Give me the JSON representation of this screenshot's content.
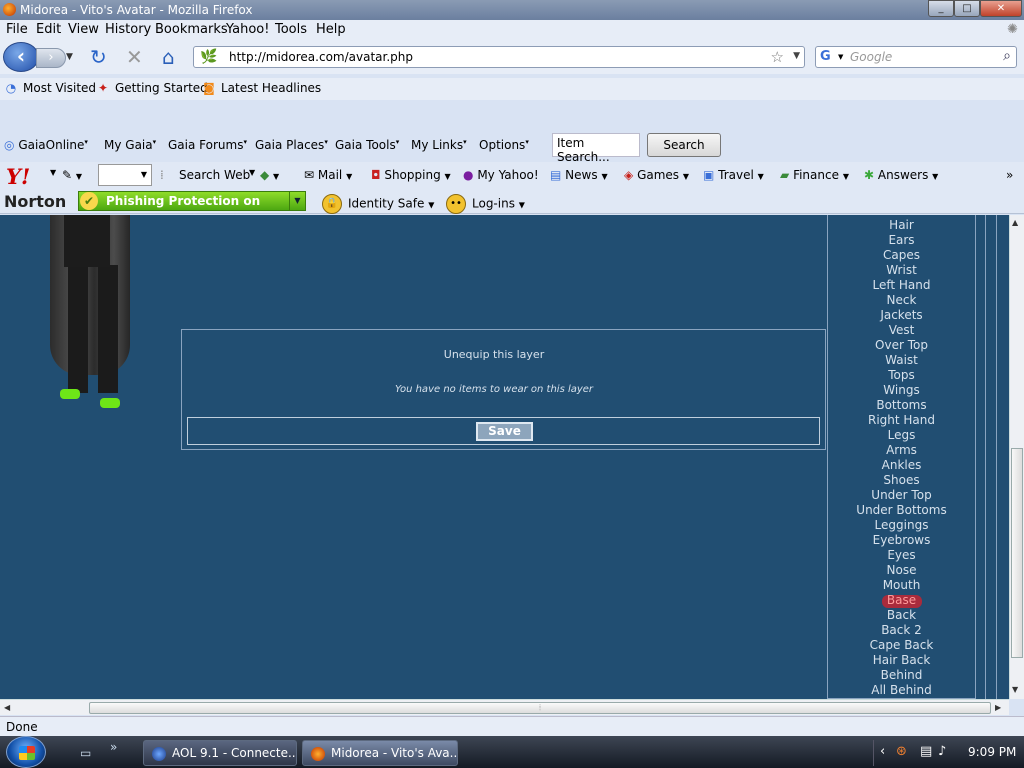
{
  "window": {
    "title": "Midorea - Vito's Avatar - Mozilla Firefox",
    "min": "_",
    "max": "□",
    "close": "✕"
  },
  "menu": [
    "File",
    "Edit",
    "View",
    "History",
    "Bookmarks",
    "Yahoo!",
    "Tools",
    "Help"
  ],
  "nav": {
    "url": "http://midorea.com/avatar.php",
    "search_placeholder": "Google",
    "icons": [
      "back-icon",
      "forward-icon",
      "reload-icon",
      "stop-icon",
      "home-icon",
      "bookmark-star-icon",
      "search-icon"
    ]
  },
  "bookmarks": [
    {
      "label": "Most Visited",
      "icon": "most-visited-icon"
    },
    {
      "label": "Getting Started",
      "icon": "getting-started-icon"
    },
    {
      "label": "Latest Headlines",
      "icon": "rss-icon"
    }
  ],
  "gaia": {
    "items": [
      "GaiaOnline",
      "My Gaia",
      "Gaia Forums",
      "Gaia Places",
      "Gaia Tools",
      "My Links",
      "Options"
    ],
    "item_search": "Item Search...",
    "search_button": "Search"
  },
  "yahoo": {
    "logo": "Y!",
    "items": [
      "Search Web",
      "Mail",
      "Shopping",
      "My Yahoo!",
      "News",
      "Games",
      "Travel",
      "Finance",
      "Answers"
    ],
    "overflow": "»"
  },
  "norton": {
    "logo": "Norton",
    "phishing": "Phishing Protection on",
    "identity_safe": "Identity Safe",
    "logins": "Log-ins"
  },
  "avatar_page": {
    "unequip": "Unequip this layer",
    "no_items": "You have no items to wear on this layer",
    "save_button": "Save",
    "layers": [
      "Hair",
      "Ears",
      "Capes",
      "Wrist",
      "Left Hand",
      "Neck",
      "Jackets",
      "Vest",
      "Over Top",
      "Waist",
      "Tops",
      "Wings",
      "Bottoms",
      "Right Hand",
      "Legs",
      "Arms",
      "Ankles",
      "Shoes",
      "Under Top",
      "Under Bottoms",
      "Leggings",
      "Eyebrows",
      "Eyes",
      "Nose",
      "Mouth",
      "Base",
      "Back",
      "Back 2",
      "Cape Back",
      "Hair Back",
      "Behind",
      "All Behind"
    ],
    "selected_layer": "Base",
    "colors": {
      "background": "#214e72",
      "selected_highlight": "#a92b3c",
      "shoe_accent": "#6ee617"
    }
  },
  "status": "Done",
  "taskbar": {
    "tasks": [
      "AOL 9.1 - Connecte...",
      "Midorea - Vito's Ava..."
    ],
    "clock": "9:09 PM"
  }
}
